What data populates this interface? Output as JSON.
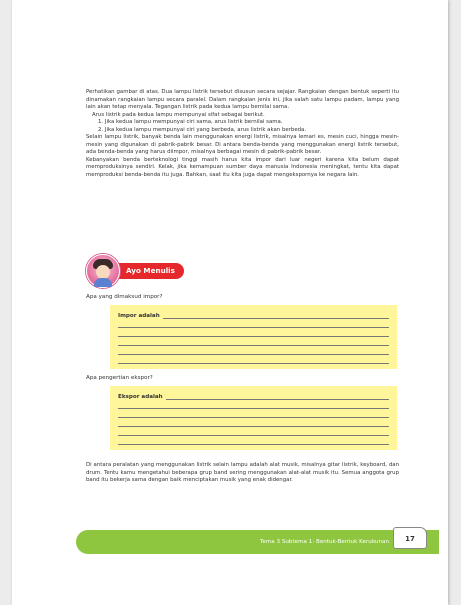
{
  "paragraphs_intro": {
    "p1": "Perhatikan gambar di atas. Dua lampu listrik tersebut disusun secara sejajar. Rangkaian dengan bentuk seperti itu dinamakan rangkaian lampu secara paralel. Dalam rangkaian jenis ini, jika salah satu lampu padam, lampu yang lain akan tetap menyala. Tegangan listrik pada kedua lampu bernilai sama.",
    "p2": "Arus listrik pada kedua lampu mempunyai sifat sebagai berikut.",
    "li1": "1. Jika kedua lampu mempunyai ciri sama, arus listrik bernilai sama.",
    "li2": "2. Jika kedua lampu mempunyai ciri yang berbeda, arus listrik akan berbeda.",
    "p3": "Selain lampu listrik, banyak benda lain menggunakan energi listrik, misalnya lemari es, mesin cuci, hingga mesin-mesin yang digunakan di pabrik-pabrik besar. Di antara benda-benda yang menggunakan energi listrik tersebut, ada benda-benda yang harus diimpor, misalnya berbagai mesin di pabrik-pabrik besar.",
    "p4": "Kebanyakan benda berteknologi tinggi masih harus kita impor dari luar negeri karena kita belum dapat memproduksinya sendiri. Kelak, jika kemampuan sumber daya manusia Indonesia meningkat, tentu kita dapat memproduksi benda-benda itu juga. Bahkan, saat itu kita juga dapat mengekspornya ke negara lain."
  },
  "activity": {
    "label": "Ayo Menulis"
  },
  "question1": {
    "text": "Apa yang dimaksud impor?",
    "answer_label": "Impor adalah",
    "extra_lines": 5
  },
  "question2": {
    "text": "Apa pengertian ekspor?",
    "answer_label": "Ekspor adalah",
    "extra_lines": 5
  },
  "closing": {
    "text": "Di antara peralatan yang menggunakan listrik selain lampu adalah alat musik, misalnya gitar listrik, keyboard, dan drum. Tentu kamu mengetahui beberapa grup band sering menggunakan alat-alat musik itu. Semua anggota grup band itu bekerja sama dengan baik menciptakan musik yang enak didengar."
  },
  "footer": {
    "text": "Tema 3 Subtema 1: Bentuk-Bentuk Kerukunan",
    "page_number": "17"
  },
  "colors": {
    "answer_bg": "#fff59a",
    "heading_red": "#e4282c",
    "footer_green": "#8ec63f"
  }
}
